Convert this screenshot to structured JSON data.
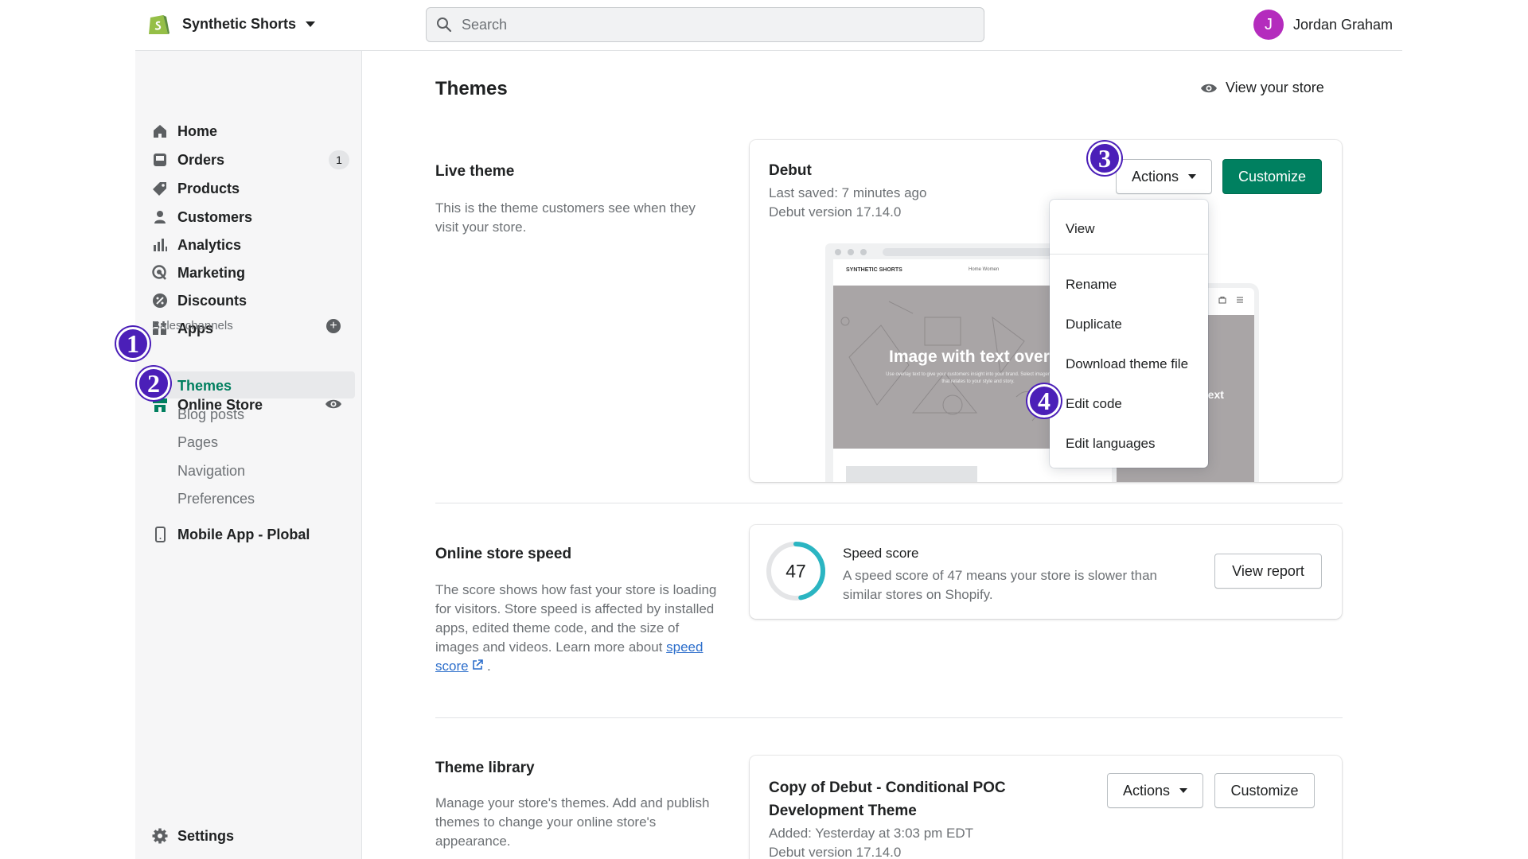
{
  "topbar": {
    "store_name": "Synthetic Shorts",
    "search_placeholder": "Search",
    "user_initial": "J",
    "user_name": "Jordan Graham"
  },
  "sidebar": {
    "items": [
      {
        "label": "Home",
        "icon": "home-icon"
      },
      {
        "label": "Orders",
        "icon": "orders-icon",
        "badge": "1"
      },
      {
        "label": "Products",
        "icon": "tag-icon"
      },
      {
        "label": "Customers",
        "icon": "person-icon"
      },
      {
        "label": "Analytics",
        "icon": "bar-chart-icon"
      },
      {
        "label": "Marketing",
        "icon": "target-icon"
      },
      {
        "label": "Discounts",
        "icon": "discount-icon"
      },
      {
        "label": "Apps",
        "icon": "apps-icon"
      }
    ],
    "sales_channels_label": "Sales channels",
    "online_store_label": "Online Store",
    "sub_items": [
      "Themes",
      "Blog posts",
      "Pages",
      "Navigation",
      "Preferences"
    ],
    "mobile_app_label": "Mobile App - Plobal",
    "settings_label": "Settings"
  },
  "steps": [
    "1",
    "2",
    "3",
    "4"
  ],
  "main": {
    "page_title": "Themes",
    "view_store_label": "View your store",
    "live_theme": {
      "section_title": "Live theme",
      "section_desc": "This is the theme customers see when they visit your store.",
      "theme_name": "Debut",
      "last_saved": "Last saved: 7 minutes ago",
      "version": "Debut version 17.14.0",
      "actions_label": "Actions",
      "customize_label": "Customize",
      "preview": {
        "site_name": "SYNTHETIC SHORTS",
        "site_links": "Home   Women",
        "hero_title": "Image with text overla",
        "hero_sub": "Use overlay text to give your customers insight into your brand. Select imagery and text that relates to your style and story.",
        "mobile_text": "text"
      }
    },
    "actions_menu": [
      "View",
      "Rename",
      "Duplicate",
      "Download theme file",
      "Edit code",
      "Edit languages"
    ],
    "speed": {
      "section_title": "Online store speed",
      "desc_text": "The score shows how fast your store is loading for visitors. Store speed is affected by installed apps, edited theme code, and the size of images and videos. Learn more about",
      "link_label": "speed score",
      "desc_end": ".",
      "score": "47",
      "score_fraction": 0.47,
      "card_title": "Speed score",
      "card_desc": "A speed score of 47 means your store is slower than similar stores on Shopify.",
      "view_report_label": "View report"
    },
    "library": {
      "section_title": "Theme library",
      "section_desc": "Manage your store's themes. Add and publish themes to change your online store's appearance.",
      "theme_name": "Copy of Debut - Conditional POC Development Theme",
      "added": "Added: Yesterday at 3:03 pm EDT",
      "version": "Debut version 17.14.0",
      "actions_label": "Actions",
      "customize_label": "Customize"
    }
  },
  "colors": {
    "brand_green": "#008060",
    "active_nav": "#007f5f",
    "step_marker": "#4b1fb8",
    "avatar": "#b42cbd",
    "gauge": "#2bb5c2"
  }
}
